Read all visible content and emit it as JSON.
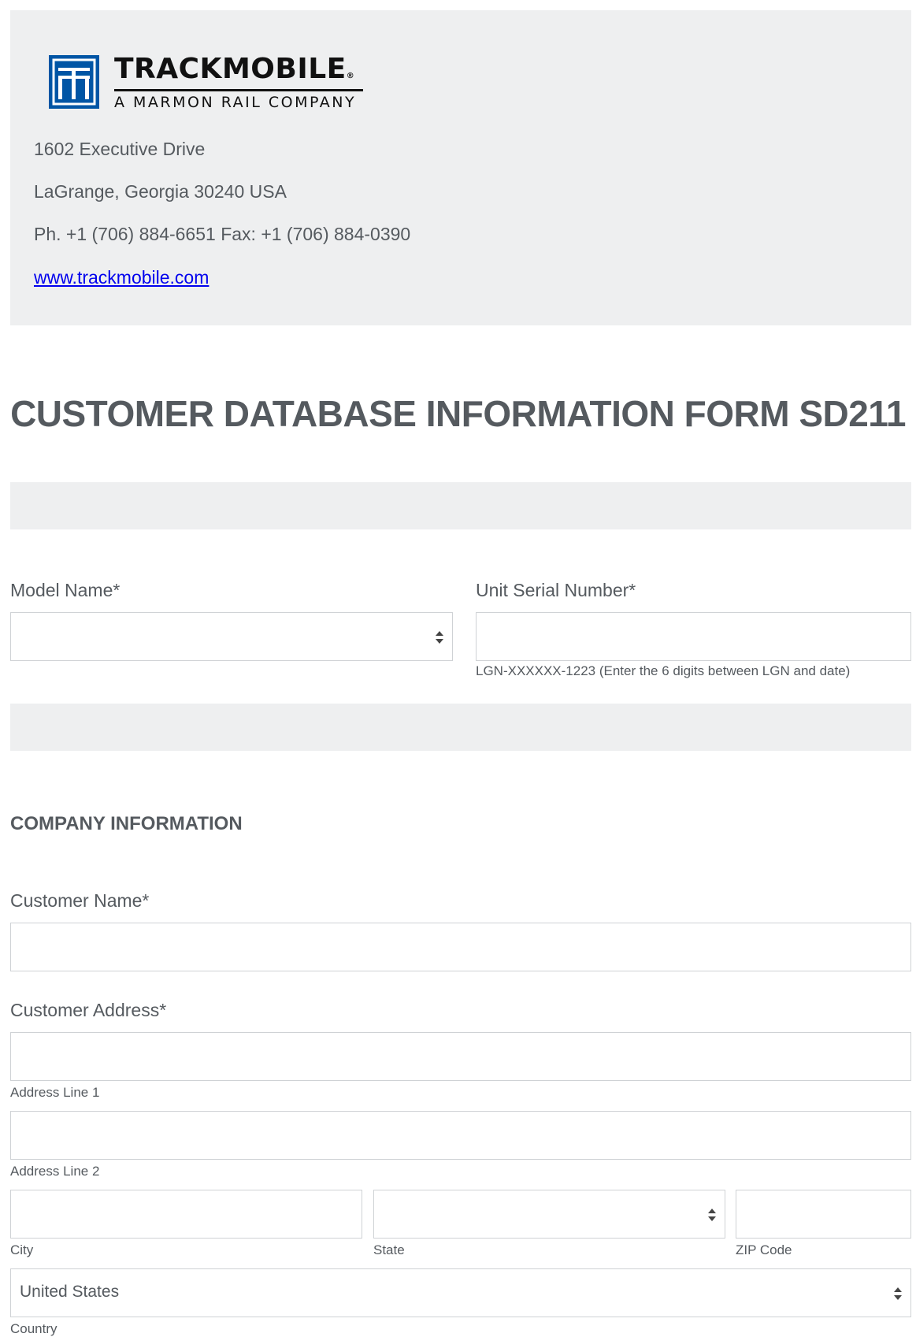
{
  "header": {
    "logo": {
      "name": "TRACKMOBILE",
      "registered": "®",
      "tagline": "A MARMON RAIL COMPANY"
    },
    "address_line_1": "1602 Executive Drive",
    "address_line_2": "LaGrange, Georgia 30240 USA",
    "contact": "Ph. +1 (706) 884-6651 Fax: +1 (706) 884-0390",
    "website": "www.trackmobile.com"
  },
  "form": {
    "title": "CUSTOMER DATABASE INFORMATION FORM SD211",
    "model_name": {
      "label": "Model Name*",
      "value": ""
    },
    "unit_serial": {
      "label": "Unit Serial Number*",
      "value": "",
      "hint": "LGN-XXXXXX-1223 (Enter the 6 digits between LGN and date)"
    },
    "company_section": {
      "heading": "COMPANY INFORMATION",
      "customer_name": {
        "label": "Customer Name*",
        "value": ""
      },
      "customer_address": {
        "label": "Customer Address*",
        "line1_label": "Address Line 1",
        "line2_label": "Address Line 2",
        "city_label": "City",
        "state_label": "State",
        "zip_label": "ZIP Code",
        "country_label": "Country",
        "country_value": "United States"
      }
    }
  },
  "colors": {
    "panel_bg": "#eeeff0",
    "text": "#555a5f",
    "link": "#0000ee",
    "logo_blue": "#0055a5",
    "field_border": "#cfd2d5"
  }
}
